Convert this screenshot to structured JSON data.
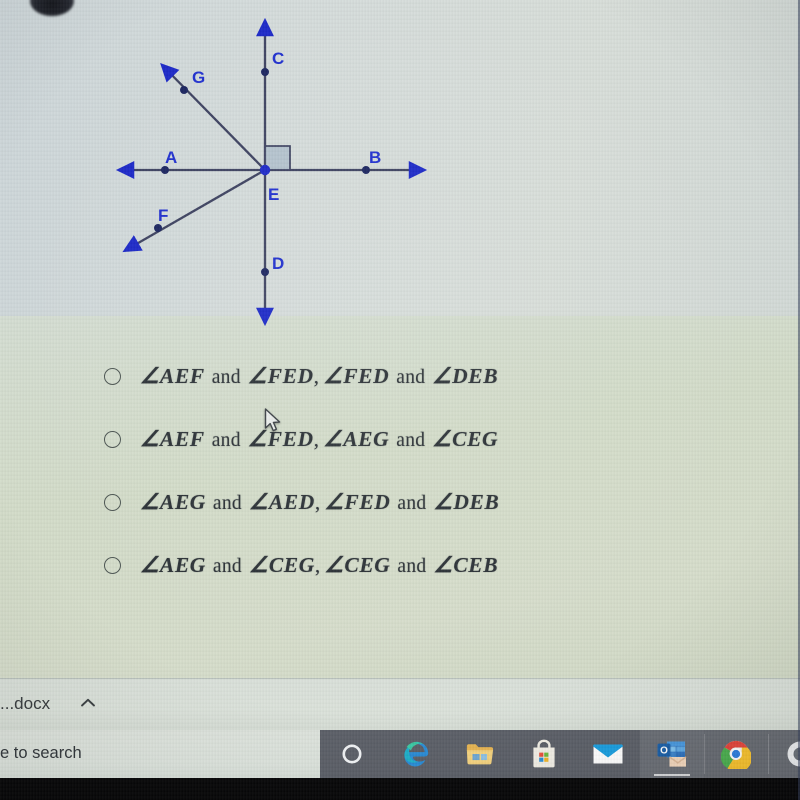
{
  "figure": {
    "title": "intersecting-rays-geometry-diagram",
    "center_label": "E",
    "labels": {
      "A": "A",
      "B": "B",
      "C": "C",
      "D": "D",
      "E": "E",
      "F": "F",
      "G": "G"
    },
    "line_color": "#3c4160",
    "marker_color": "#1b28c8",
    "label_color": "#1f2fcf",
    "right_angle_fill": "#9fb3c6",
    "right_angle_note": "right angle marked between ray EC and ray EB"
  },
  "question": {
    "options": [
      {
        "id": "option-1",
        "selected": false,
        "parts": [
          {
            "angle": "∠AEF",
            "and": "and",
            "angle2": "∠FED"
          },
          {
            "angle": "∠FED",
            "and": "and",
            "angle2": "∠DEB"
          }
        ]
      },
      {
        "id": "option-2",
        "selected": false,
        "parts": [
          {
            "angle": "∠AEF",
            "and": "and",
            "angle2": "∠FED"
          },
          {
            "angle": "∠AEG",
            "and": "and",
            "angle2": "∠CEG"
          }
        ]
      },
      {
        "id": "option-3",
        "selected": false,
        "parts": [
          {
            "angle": "∠AEG",
            "and": "and",
            "angle2": "∠AED"
          },
          {
            "angle": "∠FED",
            "and": "and",
            "angle2": "∠DEB"
          }
        ]
      },
      {
        "id": "option-4",
        "selected": false,
        "parts": [
          {
            "angle": "∠AEG",
            "and": "and",
            "angle2": "∠CEG"
          },
          {
            "angle": "∠CEG",
            "and": "and",
            "angle2": "∠CEB"
          }
        ]
      }
    ]
  },
  "download_bar": {
    "file_label": "...docx",
    "chevron": "chevron-up-icon"
  },
  "taskbar": {
    "search_text": "e to search",
    "buttons": [
      {
        "name": "cortana-button",
        "icon": "cortana-circle-icon"
      },
      {
        "name": "edge-button",
        "icon": "microsoft-edge-icon"
      },
      {
        "name": "file-explorer-button",
        "icon": "file-explorer-icon"
      },
      {
        "name": "microsoft-store-button",
        "icon": "microsoft-store-icon"
      },
      {
        "name": "mail-button",
        "icon": "mail-envelope-icon"
      },
      {
        "name": "outlook-button",
        "icon": "outlook-icon"
      },
      {
        "name": "chrome-button",
        "icon": "google-chrome-icon"
      },
      {
        "name": "partial-app-button",
        "icon": "partial-app-icon"
      }
    ]
  },
  "colors": {
    "page_upper_bg": "#d5dcdb",
    "page_lower_bg": "#d3dcc9",
    "text": "#2b3136",
    "taskbar_bg": "#5c6068",
    "diagram_blue": "#1f2fcf"
  }
}
